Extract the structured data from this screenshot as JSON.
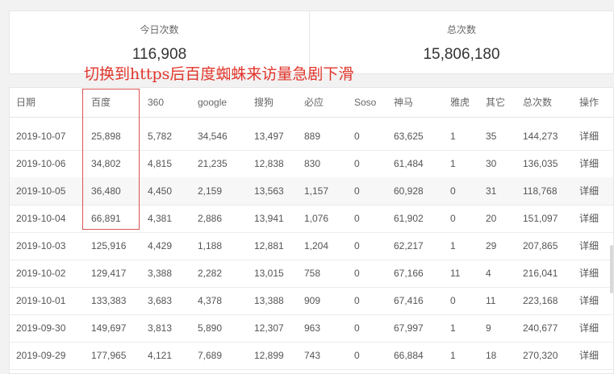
{
  "stats": {
    "today_label": "今日次数",
    "today_value": "116,908",
    "total_label": "总次数",
    "total_value": "15,806,180"
  },
  "annotation": "切换到https后百度蜘蛛来访量急剧下滑",
  "table": {
    "headers": [
      "日期",
      "百度",
      "360",
      "google",
      "搜狗",
      "必应",
      "Soso",
      "神马",
      "雅虎",
      "其它",
      "总次数",
      "操作"
    ],
    "rows": [
      [
        "2019-10-07",
        "25,898",
        "5,782",
        "34,546",
        "13,497",
        "889",
        "0",
        "63,625",
        "1",
        "35",
        "144,273",
        "详细"
      ],
      [
        "2019-10-06",
        "34,802",
        "4,815",
        "21,235",
        "12,838",
        "830",
        "0",
        "61,484",
        "1",
        "30",
        "136,035",
        "详细"
      ],
      [
        "2019-10-05",
        "36,480",
        "4,450",
        "2,159",
        "13,563",
        "1,157",
        "0",
        "60,928",
        "0",
        "31",
        "118,768",
        "详细"
      ],
      [
        "2019-10-04",
        "66,891",
        "4,381",
        "2,886",
        "13,941",
        "1,076",
        "0",
        "61,902",
        "0",
        "20",
        "151,097",
        "详细"
      ],
      [
        "2019-10-03",
        "125,916",
        "4,429",
        "1,188",
        "12,881",
        "1,204",
        "0",
        "62,217",
        "1",
        "29",
        "207,865",
        "详细"
      ],
      [
        "2019-10-02",
        "129,417",
        "3,388",
        "2,282",
        "13,015",
        "758",
        "0",
        "67,166",
        "11",
        "4",
        "216,041",
        "详细"
      ],
      [
        "2019-10-01",
        "133,383",
        "3,683",
        "4,378",
        "13,388",
        "909",
        "0",
        "67,416",
        "0",
        "11",
        "223,168",
        "详细"
      ],
      [
        "2019-09-30",
        "149,697",
        "3,813",
        "5,890",
        "12,307",
        "963",
        "0",
        "67,997",
        "1",
        "9",
        "240,677",
        "详细"
      ],
      [
        "2019-09-29",
        "177,965",
        "4,121",
        "7,689",
        "12,899",
        "743",
        "0",
        "66,884",
        "1",
        "18",
        "270,320",
        "详细"
      ]
    ]
  },
  "colors": {
    "annotation": "#e0352b",
    "detail_link": "#2e9e3e",
    "highlight_border": "#d9534f"
  }
}
